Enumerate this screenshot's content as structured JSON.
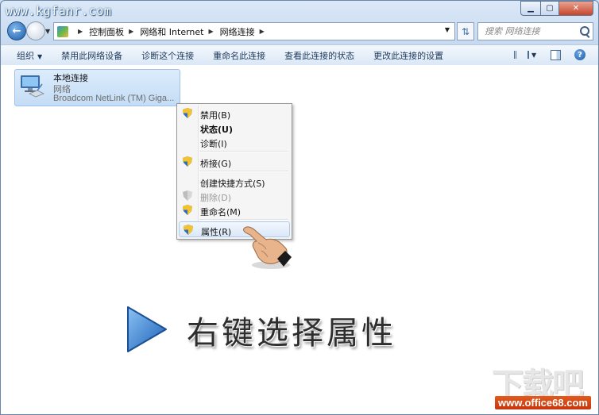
{
  "window": {
    "watermark_url": "www.kgfanr.com",
    "caption_buttons": {
      "minimize": "▁",
      "maximize": "▢",
      "close": "✕"
    }
  },
  "navigation": {
    "breadcrumbs": [
      "控制面板",
      "网络和 Internet",
      "网络连接"
    ],
    "search_placeholder": "搜索 网络连接"
  },
  "toolbar": {
    "organize": "组织",
    "commands": [
      "禁用此网络设备",
      "诊断这个连接",
      "重命名此连接",
      "查看此连接的状态",
      "更改此连接的设置"
    ]
  },
  "connection": {
    "name": "本地连接",
    "status": "网络",
    "device": "Broadcom NetLink (TM) Giga..."
  },
  "context_menu": {
    "items": [
      {
        "label": "禁用(B)",
        "icon": "shield-icon"
      },
      {
        "label": "状态(U)",
        "bold": true
      },
      {
        "label": "诊断(I)"
      },
      {
        "label": "桥接(G)",
        "icon": "shield-icon"
      },
      {
        "label": "创建快捷方式(S)"
      },
      {
        "label": "删除(D)",
        "icon": "shield-icon",
        "disabled": true
      },
      {
        "label": "重命名(M)",
        "icon": "shield-icon"
      },
      {
        "label": "属性(R)",
        "icon": "shield-icon",
        "highlighted": true
      }
    ]
  },
  "overlay": {
    "caption": "右键选择属性",
    "logo_text": "下载吧",
    "logo_url": "www.office68.com"
  },
  "colors": {
    "accent": "#1d5ea8",
    "selection": "#c4dcf5",
    "play_button": "#2a76d2",
    "logo_orange": "#e25b1d"
  }
}
